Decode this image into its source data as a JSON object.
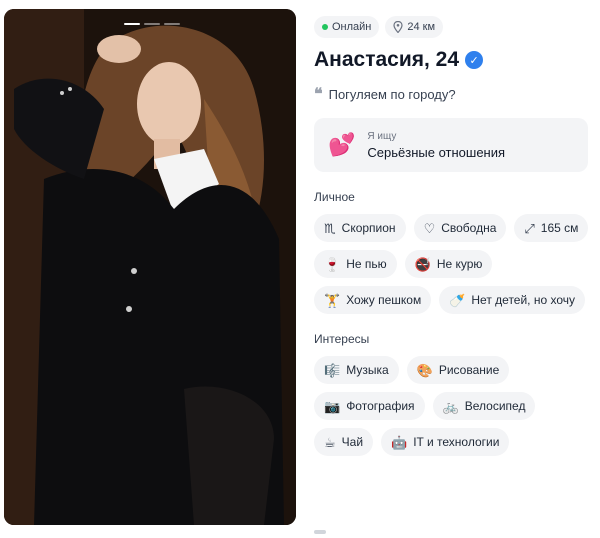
{
  "status": {
    "online": "Онлайн",
    "distance": "24 км"
  },
  "profile": {
    "name": "Анастасия, 24",
    "quote": "Погуляем по городу?"
  },
  "looking_for": {
    "label": "Я ищу",
    "value": "Серьёзные отношения"
  },
  "personal": {
    "title": "Личное",
    "items": [
      {
        "icon": "♏",
        "label": "Скорпион"
      },
      {
        "icon": "♡",
        "label": "Свободна"
      },
      {
        "icon": "⤢",
        "label": "165 см"
      },
      {
        "icon": "🍷",
        "label": "Не пью"
      },
      {
        "icon": "🚭",
        "label": "Не курю"
      },
      {
        "icon": "🏋",
        "label": "Хожу пешком"
      },
      {
        "icon": "🍼",
        "label": "Нет детей, но хочу"
      }
    ]
  },
  "interests": {
    "title": "Интересы",
    "items": [
      {
        "icon": "🎼",
        "label": "Музыка"
      },
      {
        "icon": "🎨",
        "label": "Рисование"
      },
      {
        "icon": "📷",
        "label": "Фотография"
      },
      {
        "icon": "🚲",
        "label": "Велосипед"
      },
      {
        "icon": "☕",
        "label": "Чай"
      },
      {
        "icon": "🤖",
        "label": "IT и технологии"
      }
    ]
  },
  "colors": {
    "online": "#22c55e",
    "verified": "#2f80ed",
    "chip_bg": "#f3f4f6"
  }
}
